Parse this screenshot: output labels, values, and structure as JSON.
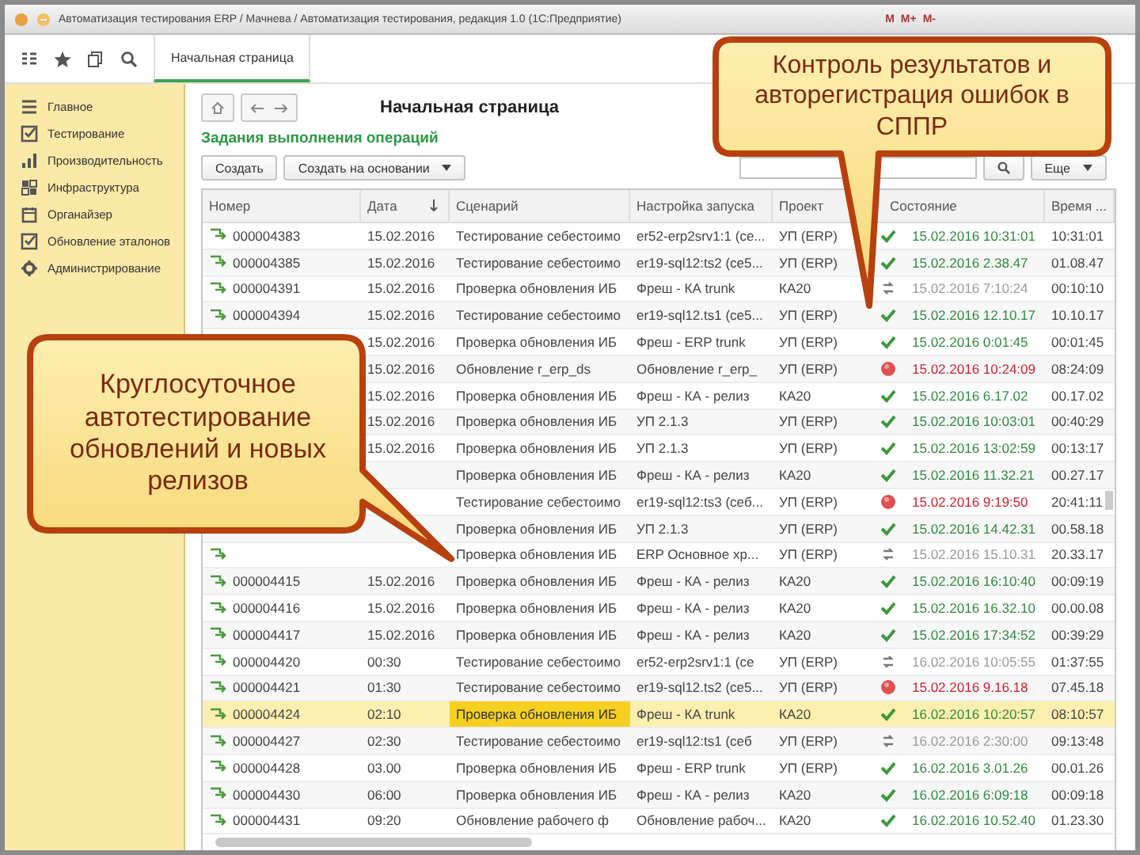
{
  "window": {
    "title": "Автоматизация тестирования ERP / Мачнева / Автоматизация тестирования, редакция 1.0 (1С:Предприятие)",
    "marks": [
      "M",
      "M+",
      "M-"
    ]
  },
  "toolbar": {
    "tabs": [
      {
        "label": "Начальная страница",
        "selected": true
      }
    ]
  },
  "sidebar": {
    "items": [
      {
        "label": "Главное",
        "kind": "menu"
      },
      {
        "label": "Тестирование",
        "kind": "check"
      },
      {
        "label": "Производительность",
        "kind": "bars"
      },
      {
        "label": "Инфраструктура",
        "kind": "grid"
      },
      {
        "label": "Органайзер",
        "kind": "calendar"
      },
      {
        "label": "Обновление эталонов",
        "kind": "check"
      },
      {
        "label": "Администрирование",
        "kind": "gear"
      }
    ]
  },
  "page": {
    "title": "Начальная страница",
    "section": "Задания выполнения операций",
    "buttons": [
      {
        "label": "Создать",
        "dropdown": false
      },
      {
        "label": "Создать на основании",
        "dropdown": true
      }
    ],
    "more_button": {
      "label": "Еще",
      "dropdown": true
    }
  },
  "table": {
    "columns": [
      {
        "label": "Номер"
      },
      {
        "label": "Дата",
        "sorted": true
      },
      {
        "label": "Сценарий"
      },
      {
        "label": "Настройка запуска"
      },
      {
        "label": "Проект"
      },
      {
        "label": "Состояние"
      },
      {
        "label": "Время ..."
      }
    ],
    "rows": [
      {
        "number": "000004383",
        "date": "15.02.2016",
        "scenario": "Тестирование себестоимо",
        "settings": "er52-erp2srv1:1 (ce...",
        "project": "УП (ERP)",
        "kind": "ok",
        "finished": "15.02.2016 10:31:01",
        "duration": "10:31:01",
        "selected": false
      },
      {
        "number": "000004385",
        "date": "15.02.2016",
        "scenario": "Тестирование себестоимо",
        "settings": "er19-sql12:ts2 (ce5...",
        "project": "УП (ERP)",
        "kind": "ok",
        "finished": "15.02.2016 2.38.47",
        "duration": "01.08.47",
        "selected": false
      },
      {
        "number": "000004391",
        "date": "15.02.2016",
        "scenario": "Проверка обновления ИБ",
        "settings": "Фреш - КА trunk",
        "project": "КА20",
        "kind": "running",
        "finished": "15.02.2016 7:10:24",
        "duration": "00:10:10",
        "selected": false
      },
      {
        "number": "000004394",
        "date": "15.02.2016",
        "scenario": "Тестирование себестоимо",
        "settings": "er19-sql12.ts1 (ce5...",
        "project": "УП (ERP)",
        "kind": "ok",
        "finished": "15.02.2016 12.10.17",
        "duration": "10.10.17",
        "selected": false
      },
      {
        "date": "15.02.2016",
        "scenario": "Проверка обновления ИБ",
        "settings": "Фреш - ERP trunk",
        "project": "УП (ERP)",
        "kind": "ok",
        "finished": "15.02.2016 0:01:45",
        "duration": "00:01:45",
        "selected": false
      },
      {
        "date": "15.02.2016",
        "scenario": "Обновление r_erp_ds",
        "settings": "Обновление r_erp_",
        "project": "УП (ERP)",
        "kind": "error",
        "finished": "15.02.2016 10:24:09",
        "duration": "08:24:09",
        "selected": false
      },
      {
        "date": "15.02.2016",
        "scenario": "Проверка обновления ИБ",
        "settings": "Фреш - КА - релиз",
        "project": "КА20",
        "kind": "ok",
        "finished": "15.02.2016 6.17.02",
        "duration": "00.17.02",
        "selected": false
      },
      {
        "date": "15.02.2016",
        "scenario": "Проверка обновления ИБ",
        "settings": "УП 2.1.3",
        "project": "УП (ERP)",
        "kind": "ok",
        "finished": "15.02.2016 10:03:01",
        "duration": "00:40:29",
        "selected": false
      },
      {
        "date": "15.02.2016",
        "scenario": "Проверка обновления ИБ",
        "settings": "УП 2.1.3",
        "project": "УП (ERP)",
        "kind": "ok",
        "finished": "15.02.2016 13:02:59",
        "duration": "00:13:17",
        "selected": false
      },
      {
        "scenario": "Проверка обновления ИБ",
        "settings": "Фреш - КА - релиз",
        "project": "КА20",
        "kind": "ok",
        "finished": "15.02.2016 11.32.21",
        "duration": "00.27.17",
        "selected": false
      },
      {
        "scenario": "Тестирование себестоимо",
        "settings": "er19-sql12:ts3 (ceб...",
        "project": "УП (ERP)",
        "kind": "error",
        "finished": "15.02.2016 9:19:50",
        "duration": "20:41:11",
        "selected": false
      },
      {
        "scenario": "Проверка обновления ИБ",
        "settings": "УП 2.1.3",
        "project": "УП (ERP)",
        "kind": "ok",
        "finished": "15.02.2016 14.42.31",
        "duration": "00.58.18",
        "selected": false
      },
      {
        "scenario": "Проверка обновления ИБ",
        "settings": "ERP Основное хр...",
        "project": "УП (ERP)",
        "kind": "running",
        "finished": "15.02.2016 15.10.31",
        "duration": "20.33.17",
        "selected": false
      },
      {
        "number": "000004415",
        "date": "15.02.2016",
        "scenario": "Проверка обновления ИБ",
        "settings": "Фреш - КА - релиз",
        "project": "КА20",
        "kind": "ok",
        "finished": "15.02.2016 16:10:40",
        "duration": "00:09:19",
        "selected": false
      },
      {
        "number": "000004416",
        "date": "15.02.2016",
        "scenario": "Проверка обновления ИБ",
        "settings": "Фреш - КА - релиз",
        "project": "КА20",
        "kind": "ok",
        "finished": "15.02.2016 16.32.10",
        "duration": "00.00.08",
        "selected": false
      },
      {
        "number": "000004417",
        "date": "15.02.2016",
        "scenario": "Проверка обновления ИБ",
        "settings": "Фреш - КА - релиз",
        "project": "КА20",
        "kind": "ok",
        "finished": "15.02.2016 17:34:52",
        "duration": "00:39:29",
        "selected": false
      },
      {
        "number": "000004420",
        "date": "00:30",
        "scenario": "Тестирование себестоимо",
        "settings": "er52-erp2srv1:1 (ce",
        "project": "УП (ERP)",
        "kind": "running",
        "finished": "16.02.2016 10:05:55",
        "duration": "01:37:55",
        "selected": false
      },
      {
        "number": "000004421",
        "date": "01:30",
        "scenario": "Тестирование себестоимо",
        "settings": "er19-sql12.ts2 (ce5...",
        "project": "УП (ERP)",
        "kind": "error",
        "finished": "15.02.2016 9.16.18",
        "duration": "07.45.18",
        "selected": false
      },
      {
        "number": "000004424",
        "date": "02:10",
        "scenario": "Проверка обновления ИБ",
        "settings": "Фреш - КА trunk",
        "project": "КА20",
        "kind": "ok",
        "finished": "16.02.2016 10:20:57",
        "duration": "08:10:57",
        "selected": true
      },
      {
        "number": "000004427",
        "date": "02:30",
        "scenario": "Тестирование себестоимо",
        "settings": "er19-sql12:ts1 (ceб",
        "project": "УП (ERP)",
        "kind": "running",
        "finished": "16.02.2016 2:30:00",
        "duration": "09:13:48",
        "selected": false
      },
      {
        "number": "000004428",
        "date": "03.00",
        "scenario": "Проверка обновления ИБ",
        "settings": "Фреш - ERP trunk",
        "project": "УП (ERP)",
        "kind": "ok",
        "finished": "16.02.2016 3.01.26",
        "duration": "00.01.26",
        "selected": false
      },
      {
        "number": "000004430",
        "date": "06:00",
        "scenario": "Проверка обновления ИБ",
        "settings": "Фреш - КА - релиз",
        "project": "КА20",
        "kind": "ok",
        "finished": "16.02.2016 6:09:18",
        "duration": "00:09:18",
        "selected": false
      },
      {
        "number": "000004431",
        "date": "09:20",
        "scenario": "Обновление рабочего ф",
        "settings": "Обновление рабоч...",
        "project": "КА20",
        "kind": "ok",
        "finished": "16.02.2016 10.52.40",
        "duration": "01.23.30",
        "selected": false
      }
    ]
  },
  "callouts": [
    {
      "text": "Контроль результатов и авторегистрация ошибок в СППР"
    },
    {
      "text": "Круглосуточное автотестирование обновлений и новых релизов"
    }
  ]
}
